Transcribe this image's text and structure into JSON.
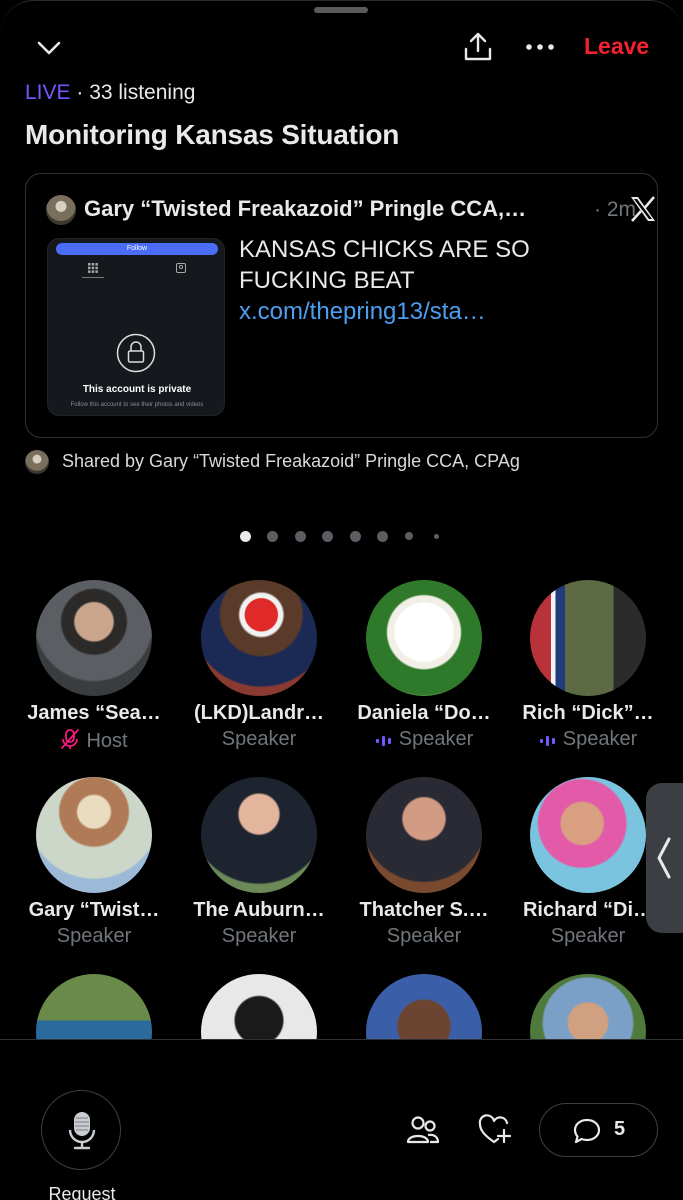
{
  "header": {
    "collapse_icon": "chevron-down-icon",
    "share_icon": "share-upload-icon",
    "more_icon": "more-dots-icon",
    "leave_label": "Leave"
  },
  "space": {
    "live_label": "LIVE",
    "listening": "· 33 listening",
    "title": "Monitoring Kansas Situation"
  },
  "pinned_post": {
    "author": "Gary “Twisted Freakazoid” Pringle CCA,…",
    "time": "· 2m",
    "platform_icon": "x-logo-icon",
    "text": "KANSAS CHICKS ARE SO FUCKING BEAT ",
    "link": "x.com/thepring13/sta…",
    "thumbnail": {
      "follow_label": "Follow",
      "private_title": "This account is private",
      "private_sub": "Follow this account to see their photos and videos"
    }
  },
  "shared_by": "Shared by Gary “Twisted Freakazoid” Pringle CCA, CPAg",
  "pager": {
    "count": 8,
    "active": 0
  },
  "speakers": [
    {
      "name": "James “Sea…",
      "role": "Host",
      "muted": true,
      "speaking": false
    },
    {
      "name": "(LKD)Landr…",
      "role": "Speaker",
      "muted": false,
      "speaking": false
    },
    {
      "name": "Daniela “Do…",
      "role": "Speaker",
      "muted": false,
      "speaking": true
    },
    {
      "name": "Rich “Dick”…",
      "role": "Speaker",
      "muted": false,
      "speaking": true
    },
    {
      "name": "Gary “Twist…",
      "role": "Speaker",
      "muted": false,
      "speaking": false
    },
    {
      "name": "The Auburn…",
      "role": "Speaker",
      "muted": false,
      "speaking": false
    },
    {
      "name": "Thatcher S.…",
      "role": "Speaker",
      "muted": false,
      "speaking": false
    },
    {
      "name": "Richard “Di…",
      "role": "Speaker",
      "muted": false,
      "speaking": false
    },
    {
      "name": "",
      "role": "",
      "muted": false,
      "speaking": false
    },
    {
      "name": "",
      "role": "",
      "muted": false,
      "speaking": false
    },
    {
      "name": "",
      "role": "",
      "muted": false,
      "speaking": false
    },
    {
      "name": "",
      "role": "",
      "muted": false,
      "speaking": false
    }
  ],
  "bottom_bar": {
    "request_label": "Request",
    "mic_icon": "microphone-icon",
    "people_icon": "people-icon",
    "reaction_icon": "heart-plus-icon",
    "comments_icon": "comment-bubble-icon",
    "comments_count": "5"
  },
  "colors": {
    "live": "#7856ff",
    "leave": "#f4212e",
    "link": "#4c9ff0",
    "muted_icon": "#f91880",
    "speaking_icon": "#7856ff"
  }
}
